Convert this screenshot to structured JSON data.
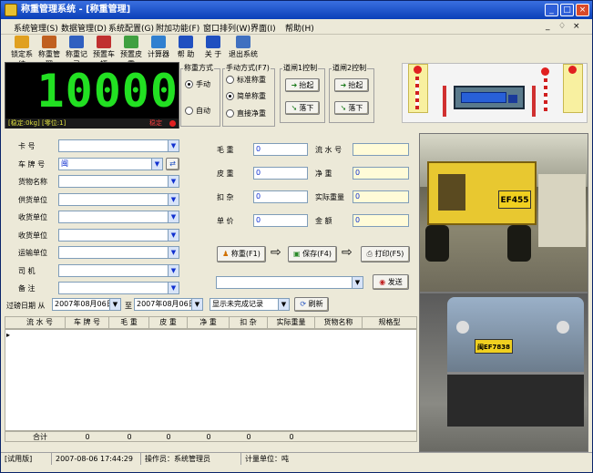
{
  "window": {
    "title": "称重管理系统 - [称重管理]"
  },
  "menu": [
    "系统管理(S)",
    "数据管理(D)",
    "系统配置(G)",
    "附加功能(F)",
    "窗口排列(W)",
    "界面(I)",
    "帮助(H)"
  ],
  "mdi_controls": [
    "_",
    "♢",
    "×"
  ],
  "toolbar": [
    {
      "label": "锁定系统",
      "icon": "lock-icon",
      "color": "#e0a020"
    },
    {
      "label": "称重管理",
      "icon": "scale-icon",
      "color": "#c06020"
    },
    {
      "label": "称重记录",
      "icon": "records-icon",
      "color": "#3060c0"
    },
    {
      "label": "预置车辆",
      "icon": "truck-icon",
      "color": "#c03030"
    },
    {
      "label": "预置皮重",
      "icon": "tare-icon",
      "color": "#40a040"
    },
    {
      "label": "计算器",
      "icon": "calculator-icon",
      "color": "#3080d0"
    },
    {
      "label": "帮 助",
      "icon": "help-icon",
      "color": "#2050c0"
    },
    {
      "label": "关 于",
      "icon": "info-icon",
      "color": "#2050c0"
    },
    {
      "label": "退出系统",
      "icon": "exit-icon",
      "color": "#4070c0"
    }
  ],
  "display": {
    "weight": "10000",
    "status_left": "[稳定:0kg]  [零位:1]",
    "status_right": "稳定"
  },
  "weigh_mode": {
    "title": "称重方式",
    "options": [
      "手动",
      "自动"
    ],
    "selected": 0
  },
  "weigh_type": {
    "title": "手动方式(F7)",
    "options": [
      "标准称重",
      "简单称重",
      "直接净重"
    ],
    "selected": 1
  },
  "gate1": {
    "title": "道闸1控制",
    "up": "抬起",
    "down": "落下"
  },
  "gate2": {
    "title": "道闸2控制",
    "up": "抬起",
    "down": "落下"
  },
  "form_left": [
    {
      "label": "卡 号",
      "value": ""
    },
    {
      "label": "车 牌 号",
      "value": "闽",
      "has_button": true
    },
    {
      "label": "货物名称",
      "value": ""
    },
    {
      "label": "供货单位",
      "value": ""
    },
    {
      "label": "收货单位",
      "value": ""
    },
    {
      "label": "收货单位",
      "value": ""
    },
    {
      "label": "运输单位",
      "value": ""
    },
    {
      "label": "司 机",
      "value": ""
    },
    {
      "label": "备 注",
      "value": ""
    }
  ],
  "form_mid": [
    {
      "label": "毛 重",
      "value": "0"
    },
    {
      "label": "皮 重",
      "value": "0"
    },
    {
      "label": "扣 杂",
      "value": "0"
    },
    {
      "label": "单 价",
      "value": "0"
    }
  ],
  "form_right": [
    {
      "label": "流 水 号",
      "value": ""
    },
    {
      "label": "净 重",
      "value": "0"
    },
    {
      "label": "实际重量",
      "value": "0"
    },
    {
      "label": "金 额",
      "value": "0"
    }
  ],
  "actions": {
    "weigh": "称重(F1)",
    "save": "保存(F4)",
    "print": "打印(F5)",
    "arrow": "⇨",
    "send": "发送"
  },
  "filter": {
    "label": "过磅日期 从",
    "from": "2007年08月06日",
    "to_label": "至",
    "to": "2007年08月06日",
    "view": "显示未完成记录",
    "refresh": "刷新"
  },
  "grid": {
    "columns": [
      "流 水 号",
      "车 牌 号",
      "毛 重",
      "皮 重",
      "净 重",
      "扣 杂",
      "实际重量",
      "货物名称",
      "规格型"
    ],
    "total_label": "合计",
    "totals": [
      "0",
      "0",
      "0",
      "0",
      "0",
      "0"
    ]
  },
  "plates": {
    "cam1": "EF455",
    "cam2": "闽EF7838"
  },
  "statusbar": [
    "[试用版]",
    "2007-08-06  17:44:29",
    "操作员：系统管理员",
    "计量单位：吨"
  ]
}
